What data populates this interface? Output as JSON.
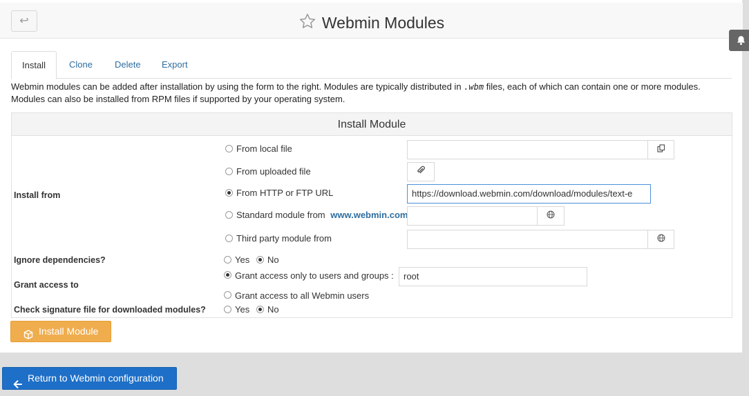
{
  "header": {
    "title": "Webmin Modules",
    "back_glyph": "↩"
  },
  "tabs": [
    "Install",
    "Clone",
    "Delete",
    "Export"
  ],
  "description": {
    "line1_pre": "Webmin modules can be added after installation by using the form to the right. Modules are typically distributed in",
    "code": ".wbm",
    "line1_post": "files, each of which can contain one or more modules.",
    "line2": "Modules can also be installed from RPM files if supported by your operating system."
  },
  "form": {
    "title": "Install Module",
    "install_from": {
      "label": "Install from",
      "options": {
        "local_file": "From local file",
        "uploaded_file": "From uploaded file",
        "http_url": "From HTTP or FTP URL",
        "standard_module": "Standard module from",
        "standard_link": "www.webmin.com",
        "third_party": "Third party module from"
      },
      "selected": "http_url",
      "url_value": "https://download.webmin.com/download/modules/text-e"
    },
    "ignore_deps": {
      "label": "Ignore dependencies?",
      "yes": "Yes",
      "no": "No",
      "selected": "no"
    },
    "grant_access": {
      "label": "Grant access to",
      "only_users": "Grant access only to users and groups :",
      "users_value": "root",
      "all_users": "Grant access to all Webmin users",
      "selected": "only_users"
    },
    "check_sig": {
      "label": "Check signature file for downloaded modules?",
      "yes": "Yes",
      "no": "No",
      "selected": "no"
    }
  },
  "buttons": {
    "install": "Install Module",
    "return": "Return to Webmin configuration"
  },
  "colors": {
    "install_button": "#f0ad4e",
    "return_button": "#1e6fc7",
    "link": "#2f6ea0"
  }
}
